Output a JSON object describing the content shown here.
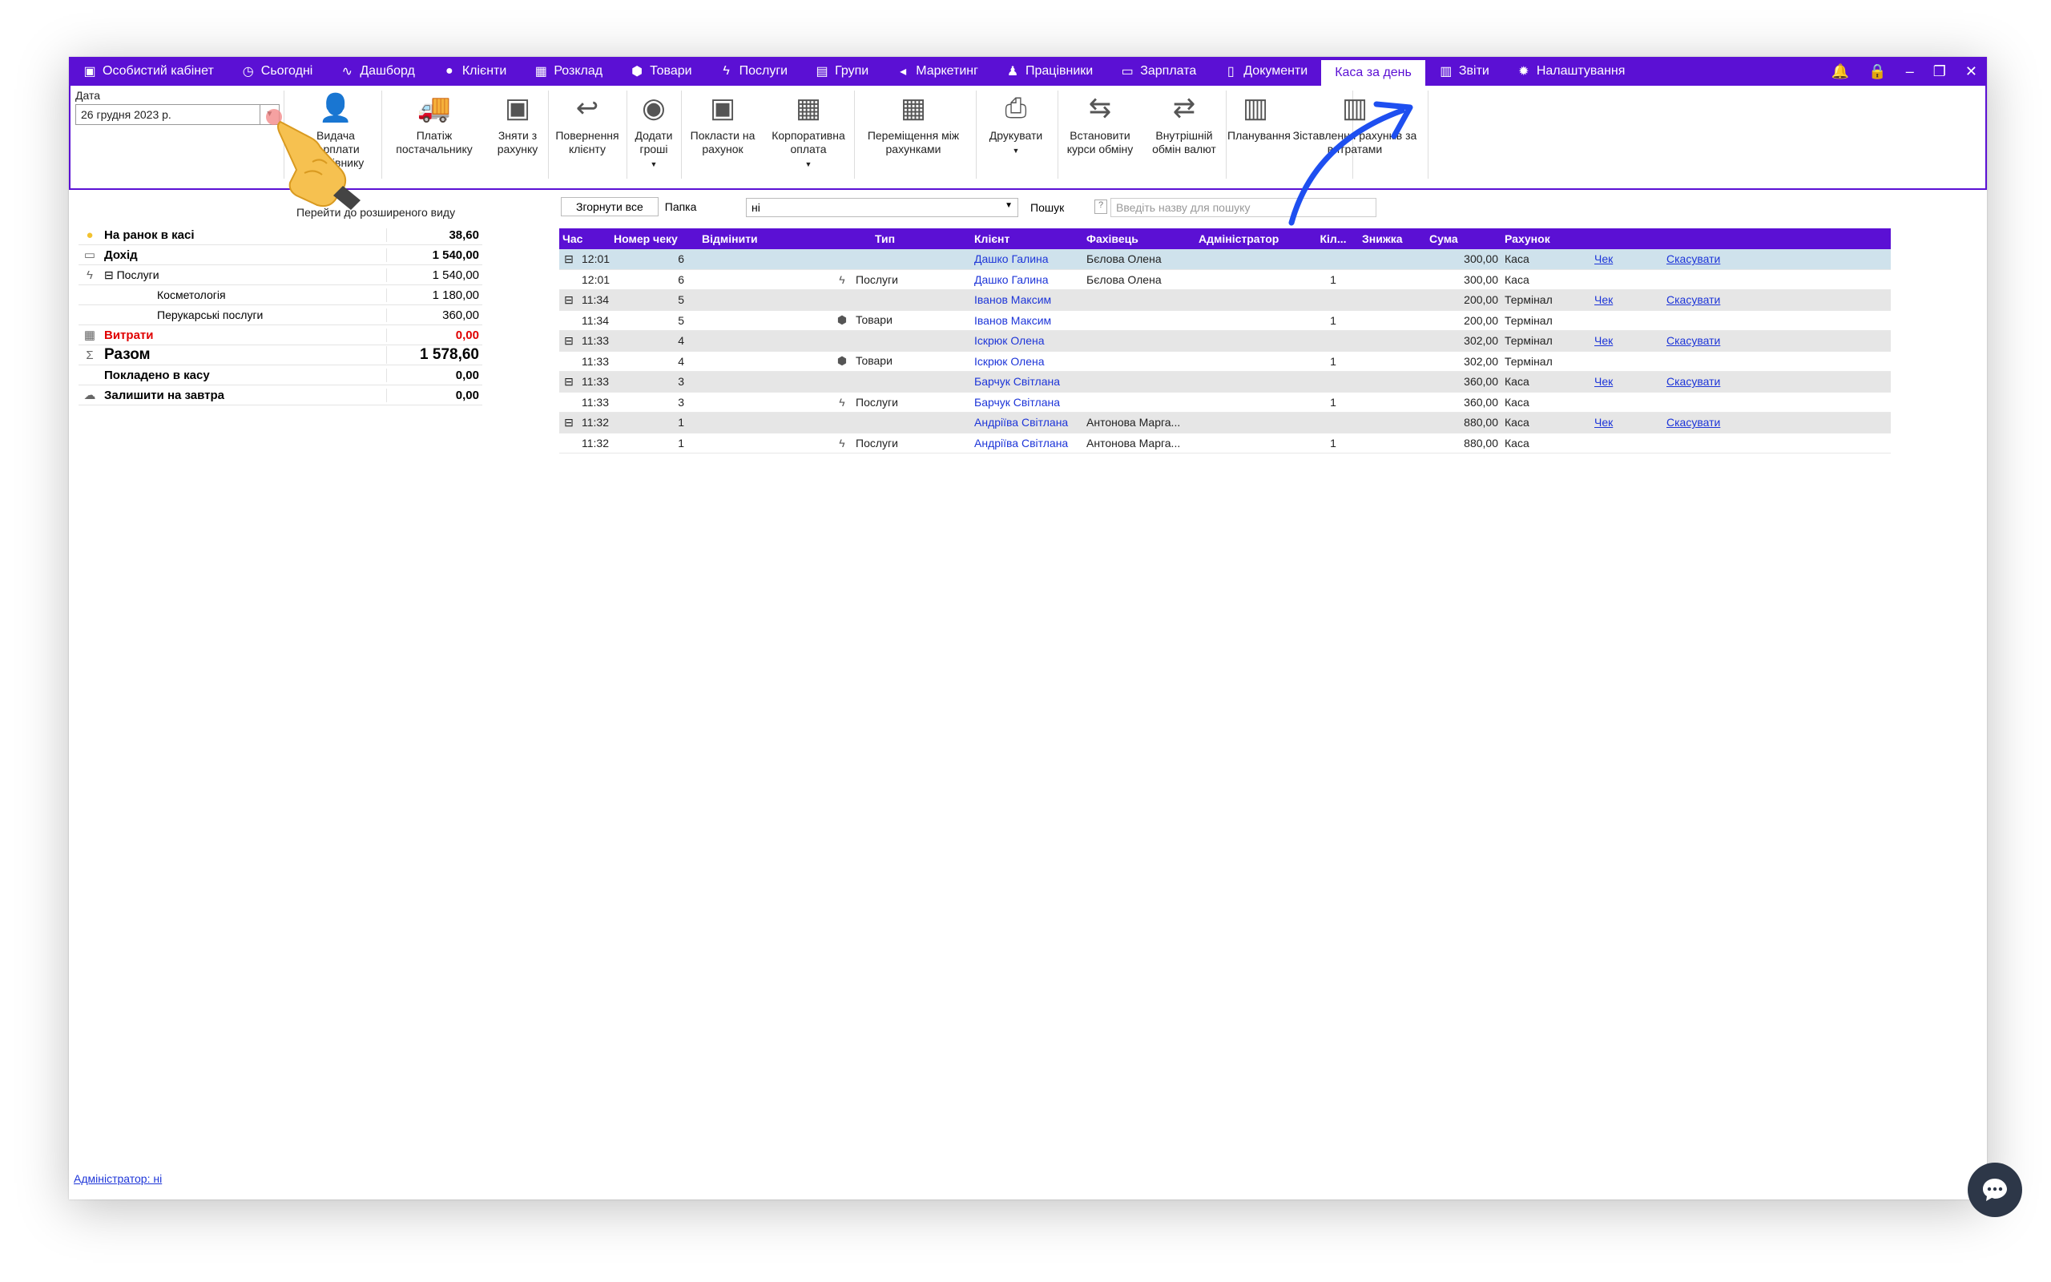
{
  "nav": {
    "items": [
      {
        "label": "Особистий кабінет",
        "icon": "wallet-icon"
      },
      {
        "label": "Сьогодні",
        "icon": "clock-icon"
      },
      {
        "label": "Дашборд",
        "icon": "pulse-icon"
      },
      {
        "label": "Клієнти",
        "icon": "user-circle-icon"
      },
      {
        "label": "Розклад",
        "icon": "calendar-icon"
      },
      {
        "label": "Товари",
        "icon": "box-icon"
      },
      {
        "label": "Послуги",
        "icon": "lightning-icon"
      },
      {
        "label": "Групи",
        "icon": "group-icon"
      },
      {
        "label": "Маркетинг",
        "icon": "megaphone-icon"
      },
      {
        "label": "Працівники",
        "icon": "person-icon"
      },
      {
        "label": "Зарплата",
        "icon": "cash-icon"
      },
      {
        "label": "Документи",
        "icon": "document-icon"
      },
      {
        "label": "Каса за день",
        "icon": ""
      },
      {
        "label": "Звіти",
        "icon": "bar-chart-icon"
      },
      {
        "label": "Налаштування",
        "icon": "gear-icon"
      }
    ],
    "active_index": 12
  },
  "window_controls": [
    "bell-icon",
    "lock-icon",
    "minimize-icon",
    "restore-icon",
    "close-icon"
  ],
  "date": {
    "label": "Дата",
    "value": "26 грудня  2023 р."
  },
  "ribbon": {
    "buttons": [
      {
        "label": "Видача зарплати працівнику",
        "icon": "salary-icon"
      },
      {
        "label": "Платіж постачальнику",
        "icon": "truck-icon"
      },
      {
        "label": "Зняти з рахунку",
        "icon": "safe-out-icon"
      },
      {
        "label": "Повернення клієнту",
        "icon": "refund-icon"
      },
      {
        "label": "Додати гроші",
        "icon": "coins-icon"
      },
      {
        "label": "Покласти на рахунок",
        "icon": "safe-in-icon"
      },
      {
        "label": "Корпоративна оплата",
        "icon": "building-icon"
      },
      {
        "label": "Переміщення між рахунками",
        "icon": "calculator-icon"
      },
      {
        "label": "Друкувати",
        "icon": "printer-icon"
      },
      {
        "label": "Встановити курси обміну",
        "icon": "exchange-rate-icon"
      },
      {
        "label": "Внутрішній обмін валют",
        "icon": "currency-swap-icon"
      },
      {
        "label": "Планування",
        "icon": "planning-chart-icon"
      },
      {
        "label": "Зіставлення рахунків за витратами",
        "icon": "compare-chart-icon"
      }
    ]
  },
  "expand_link": "Перейти до розширеного виду",
  "summary": [
    {
      "label": "На ранок в касі",
      "value": "38,60",
      "icon": "coin-icon",
      "style": "bold"
    },
    {
      "label": "Дохід",
      "value": "1 540,00",
      "icon": "cash-icon",
      "style": "bold"
    },
    {
      "label": "⊟ Послуги",
      "value": "1 540,00",
      "icon": "lightning-icon",
      "style": "sub1"
    },
    {
      "label": "Косметологія",
      "value": "1 180,00",
      "icon": "",
      "style": "sub"
    },
    {
      "label": "Перукарські послуги",
      "value": "360,00",
      "icon": "",
      "style": "sub"
    },
    {
      "label": "Витрати",
      "value": "0,00",
      "icon": "calculator-icon",
      "style": "red"
    },
    {
      "label": "Разом",
      "value": "1 578,60",
      "icon": "sigma-icon",
      "style": "big"
    },
    {
      "label": "Покладено в касу",
      "value": "0,00",
      "icon": "",
      "style": "bold"
    },
    {
      "label": "Залишити на завтра",
      "value": "0,00",
      "icon": "cloud-icon",
      "style": "bold"
    }
  ],
  "toolbar": {
    "collapse_label": "Згорнути все",
    "folder_label": "Папка",
    "folder_value": "ні",
    "search_label": "Пошук",
    "search_help": "?",
    "search_placeholder": "Введіть назву для пошуку"
  },
  "table": {
    "columns": [
      "Час",
      "Номер чеку",
      "Відмінити",
      "Тип",
      "Клієнт",
      "Фахівець",
      "Адміністратор",
      "Кіл...",
      "Знижка",
      "Сума",
      "Рахунок"
    ],
    "rows": [
      {
        "group": true,
        "time": "12:01",
        "num": "6",
        "type": "",
        "type_icon": "",
        "client": "Дашко Галина",
        "spec": "Бєлова Олена",
        "admin": "",
        "qty": "",
        "disc": "",
        "sum": "300,00",
        "acc": "Каса",
        "check": "Чек",
        "cancel": "Скасувати"
      },
      {
        "group": false,
        "time": "12:01",
        "num": "6",
        "type": "Послуги",
        "type_icon": "lightning-icon",
        "client": "Дашко Галина",
        "spec": "Бєлова Олена",
        "admin": "",
        "qty": "1",
        "disc": "",
        "sum": "300,00",
        "acc": "Каса",
        "check": "",
        "cancel": ""
      },
      {
        "group": true,
        "time": "11:34",
        "num": "5",
        "type": "",
        "type_icon": "",
        "client": "Іванов Максим",
        "spec": "",
        "admin": "",
        "qty": "",
        "disc": "",
        "sum": "200,00",
        "acc": "Термінал",
        "check": "Чек",
        "cancel": "Скасувати"
      },
      {
        "group": false,
        "time": "11:34",
        "num": "5",
        "type": "Товари",
        "type_icon": "box-icon",
        "client": "Іванов Максим",
        "spec": "",
        "admin": "",
        "qty": "1",
        "disc": "",
        "sum": "200,00",
        "acc": "Термінал",
        "check": "",
        "cancel": ""
      },
      {
        "group": true,
        "time": "11:33",
        "num": "4",
        "type": "",
        "type_icon": "",
        "client": "Іскрюк Олена",
        "spec": "",
        "admin": "",
        "qty": "",
        "disc": "",
        "sum": "302,00",
        "acc": "Термінал",
        "check": "Чек",
        "cancel": "Скасувати"
      },
      {
        "group": false,
        "time": "11:33",
        "num": "4",
        "type": "Товари",
        "type_icon": "box-icon",
        "client": "Іскрюк Олена",
        "spec": "",
        "admin": "",
        "qty": "1",
        "disc": "",
        "sum": "302,00",
        "acc": "Термінал",
        "check": "",
        "cancel": ""
      },
      {
        "group": true,
        "time": "11:33",
        "num": "3",
        "type": "",
        "type_icon": "",
        "client": "Барчук Світлана",
        "spec": "",
        "admin": "",
        "qty": "",
        "disc": "",
        "sum": "360,00",
        "acc": "Каса",
        "check": "Чек",
        "cancel": "Скасувати"
      },
      {
        "group": false,
        "time": "11:33",
        "num": "3",
        "type": "Послуги",
        "type_icon": "lightning-icon",
        "client": "Барчук Світлана",
        "spec": "",
        "admin": "",
        "qty": "1",
        "disc": "",
        "sum": "360,00",
        "acc": "Каса",
        "check": "",
        "cancel": ""
      },
      {
        "group": true,
        "time": "11:32",
        "num": "1",
        "type": "",
        "type_icon": "",
        "client": "Андріїва Світлана",
        "spec": "Антонова Марга...",
        "admin": "",
        "qty": "",
        "disc": "",
        "sum": "880,00",
        "acc": "Каса",
        "check": "Чек",
        "cancel": "Скасувати"
      },
      {
        "group": false,
        "time": "11:32",
        "num": "1",
        "type": "Послуги",
        "type_icon": "lightning-icon",
        "client": "Андріїва Світлана",
        "spec": "Антонова Марга...",
        "admin": "",
        "qty": "1",
        "disc": "",
        "sum": "880,00",
        "acc": "Каса",
        "check": "",
        "cancel": ""
      }
    ]
  },
  "footer": {
    "admin_link": "Адміністратор: ні"
  },
  "colors": {
    "accent": "#5b10d4",
    "link": "#1d35d8",
    "danger": "#e00000",
    "group_row": "#e6e6e6",
    "selected_row": "#cfe2ec"
  }
}
